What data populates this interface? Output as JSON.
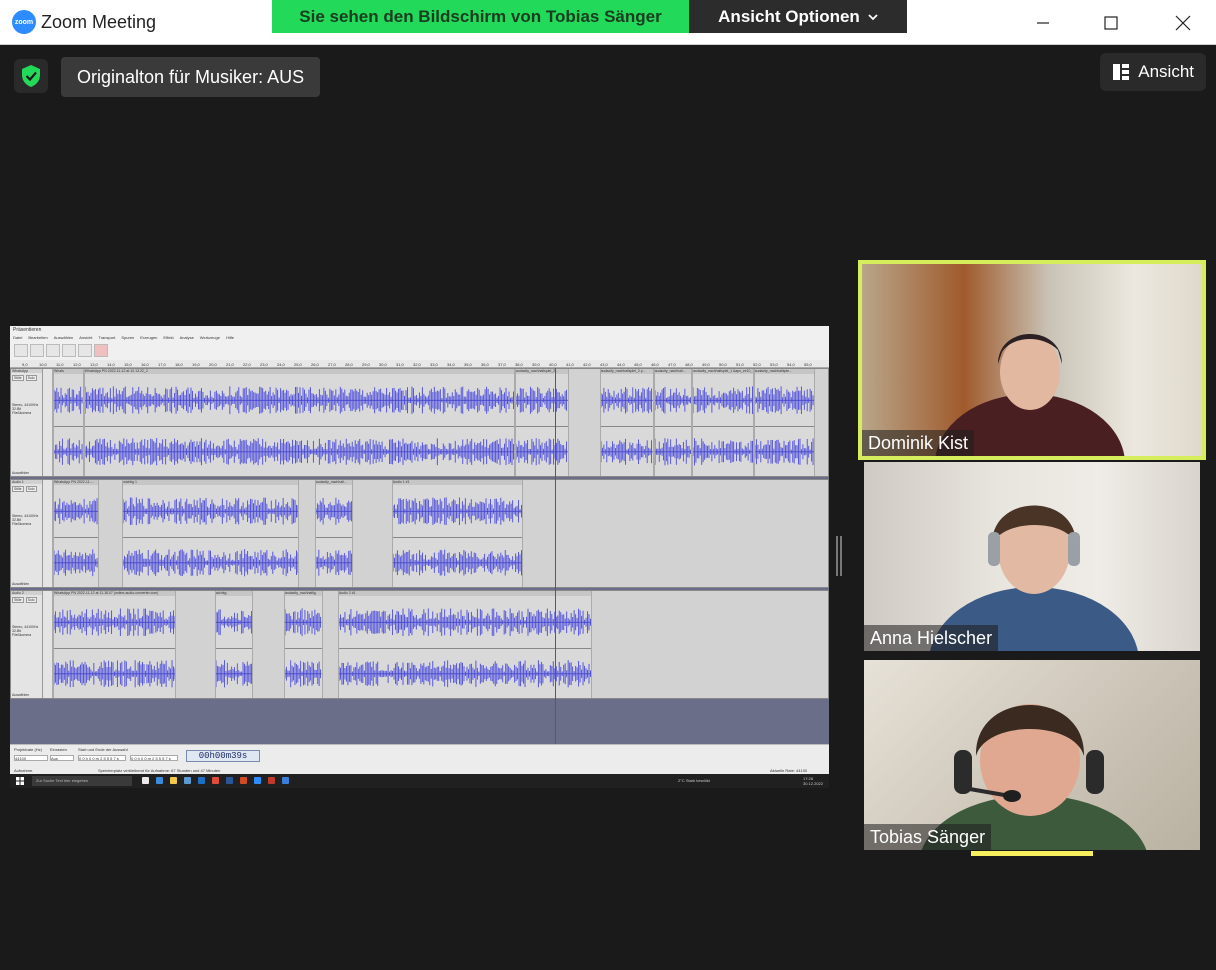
{
  "window": {
    "logo_text": "zoom",
    "title": "Zoom Meeting",
    "controls": [
      "minimize",
      "maximize",
      "close"
    ]
  },
  "share_banner": {
    "viewing_text": "Sie sehen den Bildschirm von Tobias Sänger",
    "view_options_label": "Ansicht Optionen"
  },
  "toolbar": {
    "original_sound_label": "Originalton für Musiker: AUS",
    "view_label": "Ansicht"
  },
  "shared_screen": {
    "app_title": "Präsentieren",
    "menu": [
      "Datei",
      "Bearbeiten",
      "Auswählen",
      "Ansicht",
      "Transport",
      "Spuren",
      "Erzeugen",
      "Effekt",
      "Analyse",
      "Werkzeuge",
      "Hilfe"
    ],
    "ruler_ticks": [
      "9,0",
      "10,0",
      "11,0",
      "12,0",
      "13,0",
      "14,0",
      "15,0",
      "16,0",
      "17,0",
      "18,0",
      "19,0",
      "20,0",
      "21,0",
      "22,0",
      "23,0",
      "24,0",
      "25,0",
      "26,0",
      "27,0",
      "28,0",
      "29,0",
      "30,0",
      "31,0",
      "32,0",
      "33,0",
      "34,0",
      "35,0",
      "36,0",
      "37,0",
      "38,0",
      "39,0",
      "40,0",
      "41,0",
      "42,0",
      "43,0",
      "44,0",
      "45,0",
      "46,0",
      "47,0",
      "48,0",
      "49,0",
      "50,0",
      "51,0",
      "52,0",
      "53,0",
      "54,0",
      "55,0"
    ],
    "tracks": [
      {
        "name": "WhatsApp",
        "info": "Stereo, 44100Hz 32-Bit Fließkomma",
        "clips": [
          {
            "label": "Whats",
            "start": 0.0,
            "end": 0.04
          },
          {
            "label": "WhatsApp PN 2022-11-12 at 10.13.22_2",
            "start": 0.04,
            "end": 0.6
          },
          {
            "label": "audacity_nachhallspiel_2...",
            "start": 0.6,
            "end": 0.67
          },
          {
            "label": "audacity_nachhallspiel_2 p...",
            "start": 0.71,
            "end": 0.78
          },
          {
            "label": "audacity_nachhall...",
            "start": 0.78,
            "end": 0.83
          },
          {
            "label": "audacity_nachhallspiel_1 Aaps_ze10_1",
            "start": 0.83,
            "end": 0.91
          },
          {
            "label": "audacity_nachhallspie...",
            "start": 0.91,
            "end": 0.99
          }
        ]
      },
      {
        "name": "Audio 1",
        "info": "Stereo, 44100Hz 32-Bit Fließkomma",
        "clips": [
          {
            "label": "WhatsApp PN 2022-11-...",
            "start": 0.0,
            "end": 0.06
          },
          {
            "label": "wichtig 1",
            "start": 0.09,
            "end": 0.32
          },
          {
            "label": "audacity_nachhall...",
            "start": 0.34,
            "end": 0.39
          },
          {
            "label": "Audio 1 #1",
            "start": 0.44,
            "end": 0.61
          }
        ]
      },
      {
        "name": "Audio 2",
        "info": "Stereo, 44100Hz 32-Bit Fließkomma",
        "clips": [
          {
            "label": "WhatsApp PN 2022-11-12 at 11.18.07 (online-audio-converter.com)",
            "start": 0.0,
            "end": 0.16
          },
          {
            "label": "wichtig",
            "start": 0.21,
            "end": 0.26
          },
          {
            "label": "audacity_nachhallig",
            "start": 0.3,
            "end": 0.35
          },
          {
            "label": "Audio 2 #1",
            "start": 0.37,
            "end": 0.7
          }
        ]
      }
    ],
    "track_buttons": [
      "Stille",
      "Solo"
    ],
    "select_label": "Auswählen",
    "project_rate_label": "Projektrate (Hz)",
    "project_rate_value": "44100",
    "snap_label": "Einrasten",
    "snap_value": "Aus",
    "selection_label": "Start und Ende der Auswahl",
    "selection_start": "0 0 h 0 0 m 2 5 5 5 7 s",
    "selection_end": "0 0 h 0 0 m 2 5 5 5 7 s",
    "timecode": "00h00m39s",
    "status_left": "Aufnahme.",
    "status_middle": "Speicherplatz verbleibend für Aufnahme: 67 Stunden und 47 Minuten",
    "status_right": "Aktuelle Rate: 44100",
    "taskbar_search": "Zur Suche Text hier eingeben",
    "tray_weather": "2°C Stark bewölkt",
    "tray_time": "17:28",
    "tray_date": "30.12.2022"
  },
  "participants": [
    {
      "name": "Dominik Kist",
      "active": true
    },
    {
      "name": "Anna Hielscher",
      "active": false
    },
    {
      "name": "Tobias Sänger",
      "active": false
    }
  ]
}
